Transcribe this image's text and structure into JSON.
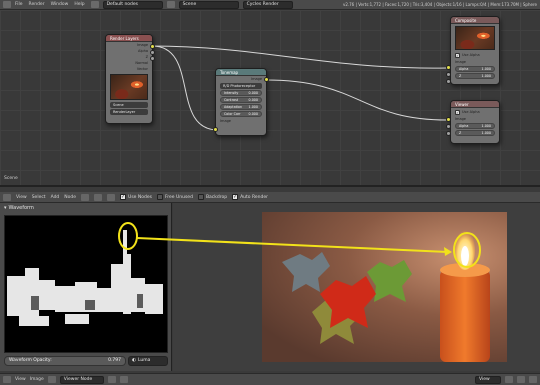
{
  "topbar": {
    "menus": [
      "File",
      "Render",
      "Window",
      "Help"
    ],
    "screen": "Default nodes",
    "scene": "Scene",
    "engine": "Cycles Render",
    "stats": "v2.76 | Verts:1,772 | Faces:1,720 | Tris:3,404 | Objects:1/16 | Lamps:0/4 | Mem:173.70M | Sphere"
  },
  "nodes": {
    "render_layers": {
      "title": "Render Layers",
      "outputs": [
        "Image",
        "Alpha",
        "Z",
        "Normal",
        "Vector"
      ],
      "scene": "Scene",
      "layer": "RenderLayer"
    },
    "tonemap": {
      "title": "Tonemap",
      "output": "Image",
      "type": "R/D Photoreceptor",
      "fields": [
        {
          "label": "Intensity",
          "value": "0.000"
        },
        {
          "label": "Contrast",
          "value": "0.000"
        },
        {
          "label": "Adaptation",
          "value": "1.000"
        },
        {
          "label": "Color Corr",
          "value": "0.000"
        }
      ],
      "input": "Image"
    },
    "composite": {
      "title": "Composite",
      "use_alpha": "Use Alpha",
      "inputs": [
        {
          "label": "Image"
        },
        {
          "label": "Alpha",
          "value": "1.000"
        },
        {
          "label": "Z",
          "value": "1.000"
        }
      ]
    },
    "viewer": {
      "title": "Viewer",
      "use_alpha": "Use Alpha",
      "inputs": [
        {
          "label": "Image"
        },
        {
          "label": "Alpha",
          "value": "1.000"
        },
        {
          "label": "Z",
          "value": "1.000"
        }
      ]
    }
  },
  "scene_label": "Scene",
  "editor_header": {
    "menus": [
      "View",
      "Select",
      "Add",
      "Node"
    ],
    "toggles": [
      {
        "label": "Use Nodes",
        "checked": true
      },
      {
        "label": "Free Unused",
        "checked": false
      },
      {
        "label": "Backdrop",
        "checked": false
      },
      {
        "label": "Auto Render",
        "checked": true
      }
    ]
  },
  "scopes": {
    "title": "Waveform",
    "opacity_label": "Waveform Opacity:",
    "opacity_value": "0.797",
    "mode": "Luma"
  },
  "bottombar": {
    "menus": [
      "View",
      "Image"
    ],
    "image": "Viewer Node",
    "view": "View"
  },
  "colors": {
    "annotation": "#f2e21a",
    "socket": "#e3df4a",
    "wire": "#d8d8d8"
  }
}
